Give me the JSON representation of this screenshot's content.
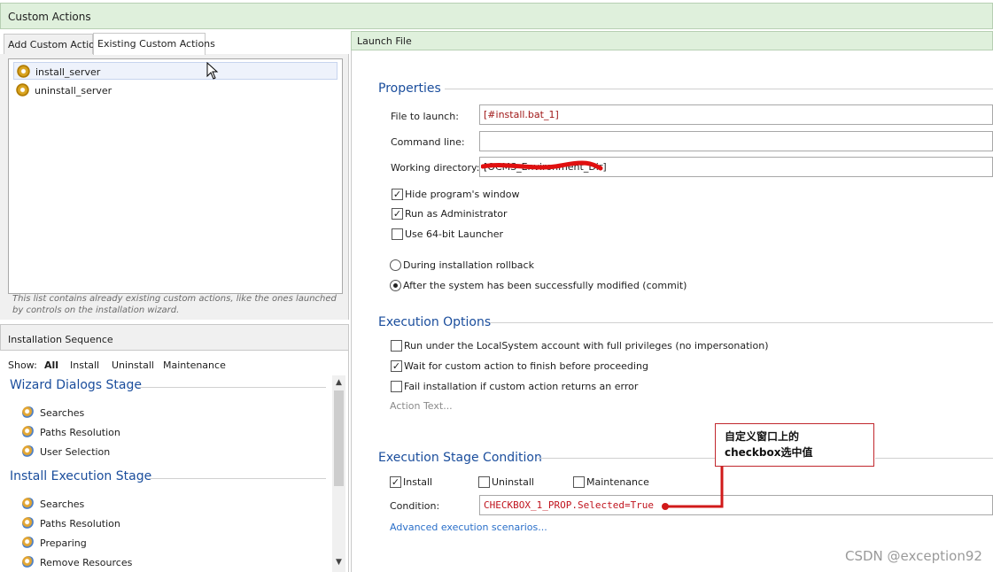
{
  "window": {
    "title": "Custom Actions"
  },
  "left": {
    "tabs": [
      {
        "label": "Add Custom Action"
      },
      {
        "label": "Existing Custom Actions"
      }
    ],
    "actions": [
      "install_server",
      "uninstall_server"
    ],
    "hint": "This list contains already existing custom actions, like the ones launched by controls on the installation wizard.",
    "sequence": {
      "title": "Installation Sequence",
      "show_label": "Show:",
      "filters": [
        "All",
        "Install",
        "Uninstall",
        "Maintenance"
      ],
      "active_filter": "All",
      "stages": [
        {
          "name": "Wizard Dialogs Stage",
          "items": [
            "Searches",
            "Paths Resolution",
            "User Selection"
          ]
        },
        {
          "name": "Install Execution Stage",
          "items": [
            "Searches",
            "Paths Resolution",
            "Preparing",
            "Remove Resources"
          ]
        }
      ]
    }
  },
  "right": {
    "header": "Launch File",
    "properties": {
      "title": "Properties",
      "file_label": "File to launch:",
      "file_value": "[#install.bat_1]",
      "cmd_label": "Command line:",
      "cmd_value": "",
      "workdir_label": "Working directory:",
      "workdir_value": "[OCMS_Environment_Dir]",
      "checks": [
        {
          "label": "Hide program's window",
          "checked": true
        },
        {
          "label": "Run as Administrator",
          "checked": true
        },
        {
          "label": "Use 64-bit Launcher",
          "checked": false
        }
      ],
      "radios": [
        {
          "label": "During installation rollback",
          "selected": false
        },
        {
          "label": "After the system has been successfully modified (commit)",
          "selected": true
        }
      ]
    },
    "execution_options": {
      "title": "Execution Options",
      "checks": [
        {
          "label": "Run under the LocalSystem account with full privileges (no impersonation)",
          "checked": false
        },
        {
          "label": "Wait for custom action to finish before proceeding",
          "checked": true
        },
        {
          "label": "Fail installation if custom action returns an error",
          "checked": false
        }
      ],
      "action_text": "Action Text..."
    },
    "stage_condition": {
      "title": "Execution Stage Condition",
      "stages": [
        {
          "label": "Install",
          "checked": true
        },
        {
          "label": "Uninstall",
          "checked": false
        },
        {
          "label": "Maintenance",
          "checked": false
        }
      ],
      "condition_label": "Condition:",
      "condition_value": "CHECKBOX_1_PROP.Selected=True",
      "advanced_link": "Advanced execution scenarios..."
    }
  },
  "annotation": {
    "line1": "自定义窗口上的",
    "line2": "checkbox选中值"
  },
  "watermark": "CSDN @exception92",
  "colors": {
    "header_bg": "#dff0dc",
    "section_title": "#1a4d9c",
    "annotation_red": "#d11a1a",
    "link": "#2a6fc9"
  }
}
